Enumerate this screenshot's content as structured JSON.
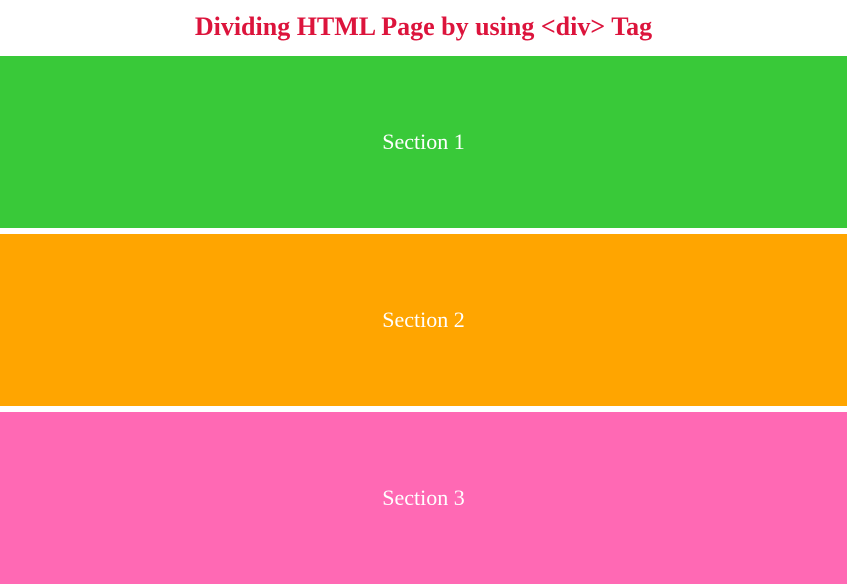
{
  "heading": "Dividing HTML Page by using <div> Tag",
  "sections": {
    "first": "Section 1",
    "second": "Section 2",
    "third": "Section 3"
  },
  "colors": {
    "heading": "#dc143c",
    "section1_bg": "#39c939",
    "section2_bg": "#ffa500",
    "section3_bg": "#ff69b4",
    "section_text": "#ffffff"
  }
}
